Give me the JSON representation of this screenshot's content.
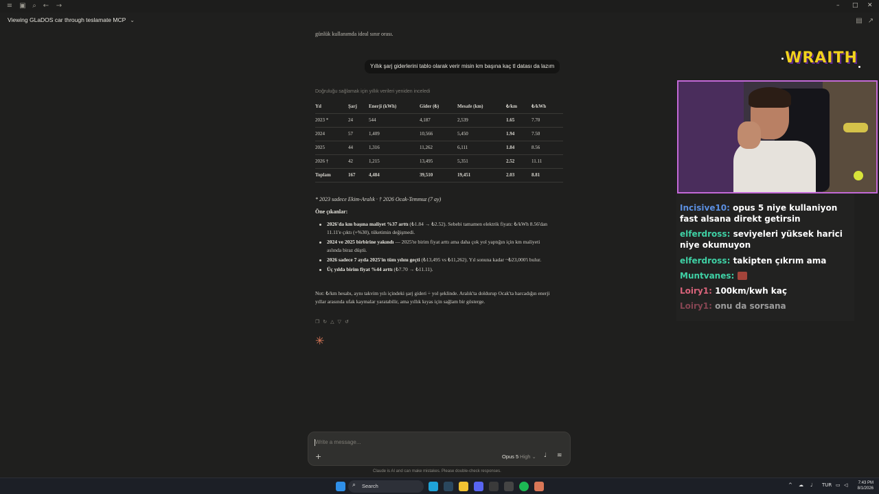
{
  "window": {
    "title": "Viewing GLaDOS car through teslamate MCP",
    "controls": {
      "minimize": "–",
      "maximize": "□",
      "close": "✕"
    }
  },
  "conversation": {
    "intro_tail": "günlük kullanımda ideal sınır orası.",
    "user_message": "Yıllık şarj giderlerini tablo olarak verir misin km başına kaç tl datası da lazım",
    "thinking_note": "Doğruluğu sağlamak için yıllık verileri yeniden inceledi",
    "table": {
      "headers": [
        "Yıl",
        "Şarj",
        "Enerji (kWh)",
        "Gider (₺)",
        "Mesafe (km)",
        "₺/km",
        "₺/kWh"
      ],
      "rows": [
        [
          "2023 *",
          "24",
          "544",
          "4,187",
          "2,539",
          "1.65",
          "7.70"
        ],
        [
          "2024",
          "57",
          "1,409",
          "10,566",
          "5,450",
          "1.94",
          "7.50"
        ],
        [
          "2025",
          "44",
          "1,316",
          "11,262",
          "6,111",
          "1.84",
          "8.56"
        ],
        [
          "2026 †",
          "42",
          "1,215",
          "13,495",
          "5,351",
          "2.52",
          "11.11"
        ]
      ],
      "total": [
        "Toplam",
        "167",
        "4,484",
        "39,510",
        "19,451",
        "2.03",
        "8.81"
      ]
    },
    "footnote": "* 2023 sadece Ekim-Aralık · † 2026 Ocak-Temmuz (7 ay)",
    "highlights_title": "Öne çıkanlar:",
    "highlights": [
      {
        "bold": "2026'da km başına maliyet %37 arttı",
        "text": " (₺1.84 → ₺2.52). Sebebi tamamen elektrik fiyatı: ₺/kWh 8.56'dan 11.11'e çıktı (+%30), tüketimin değişmedi."
      },
      {
        "bold": "2024 ve 2025 birbirine yakındı",
        "text": " — 2025'te birim fiyat arttı ama daha çok yol yaptığın için km maliyeti aslında biraz düştü."
      },
      {
        "bold": "2026 sadece 7 ayda 2025'in tüm yılını geçti",
        "text": " (₺13,495 vs ₺11,262). Yıl sonuna kadar ~₺23,000'i bulur."
      },
      {
        "bold": "Üç yılda birim fiyat %44 arttı",
        "text": " (₺7.70 → ₺11.11)."
      }
    ],
    "note": "Not: ₺/km hesabı, aynı takvim yılı içindeki şarj gideri ÷ yol şeklinde. Aralık'ta doldurup Ocak'ta harcadığın enerji yıllar arasında ufak kaymalar yaratabilir, ama yıllık kıyas için sağlam bir gösterge.",
    "actions": [
      "copy-icon",
      "retry-icon",
      "thumbs-up-icon",
      "thumbs-down-icon",
      "refresh-icon"
    ]
  },
  "composer": {
    "placeholder": "Write a message...",
    "model": "Opus 5",
    "effort": "High",
    "disclaimer": "Claude is AI and can make mistakes. Please double-check responses."
  },
  "overlay": {
    "logo": "WRAITH",
    "chat": [
      {
        "user": "Incisive10:",
        "color": "#5b8fe0",
        "text": "opus 5 niye kullaniyon fast alsana direkt getirsin"
      },
      {
        "user": "elferdross:",
        "color": "#3fd1a5",
        "text": "seviyeleri yüksek harici niye okumuyon"
      },
      {
        "user": "elferdross:",
        "color": "#3fd1a5",
        "text": "takipten çıkrım ama"
      },
      {
        "user": "Muntvanes:",
        "color": "#3fd1a5",
        "text": ""
      },
      {
        "user": "Loiry1:",
        "color": "#d9637a",
        "text": "100km/kwh kaç"
      },
      {
        "user": "Loiry1:",
        "color": "#d9637a",
        "text": "onu da sorsana"
      }
    ]
  },
  "taskbar": {
    "search": "Search",
    "lang": "TUR",
    "time": "7:43 PM",
    "date": "8/1/2026"
  },
  "colors": {
    "accent": "#d97757",
    "logo": "#f1d21f",
    "cam_border": "#c46ad8"
  }
}
